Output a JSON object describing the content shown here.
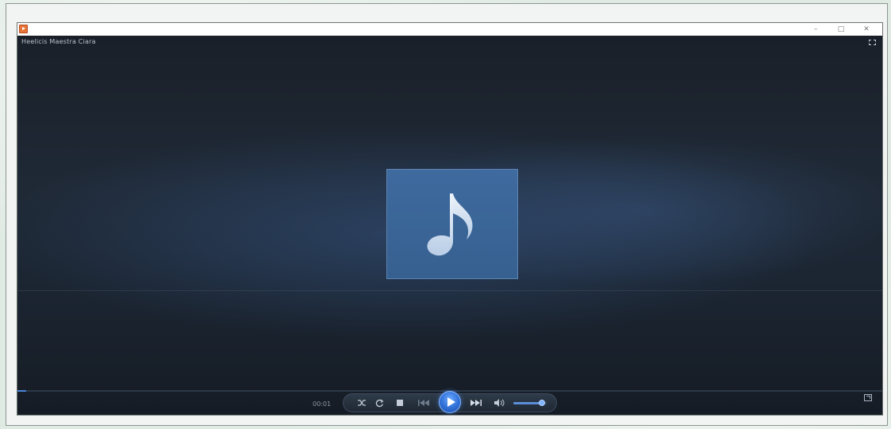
{
  "window": {
    "minimize_glyph": "–",
    "maximize_glyph": "□",
    "close_glyph": "✕"
  },
  "player": {
    "now_playing_title": "Heelicis Maestra Ciara",
    "elapsed_time": "00:01",
    "seek_progress_fraction": 0.01,
    "volume_fraction": 0.85
  },
  "icons": {
    "app": "media-player-icon",
    "album_art": "music-note-icon",
    "fullscreen": "fullscreen-icon",
    "switch_view": "switch-to-compact-view-icon"
  },
  "colors": {
    "background_dark": "#1c2633",
    "art_tile": "#3a6496",
    "accent_blue": "#2f6fd6",
    "app_icon": "#e8743a"
  }
}
